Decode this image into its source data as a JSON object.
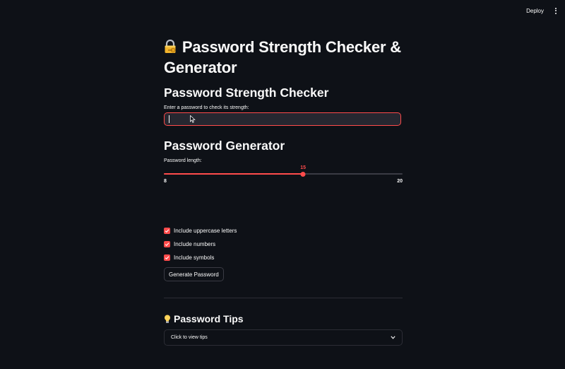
{
  "header": {
    "deploy_label": "Deploy",
    "menu_icon": "more-vertical-icon"
  },
  "page": {
    "title_line1": "Password Strength Checker &",
    "title_line2": "Generator",
    "title_icon": "lock-with-key-icon"
  },
  "checker": {
    "heading": "Password Strength Checker",
    "input_label": "Enter a password to check its strength:",
    "input_value": ""
  },
  "generator": {
    "heading": "Password Generator",
    "length_label": "Password length:",
    "length_value": 15,
    "length_min": 8,
    "length_max": 20,
    "length_value_text": "15",
    "length_min_text": "8",
    "length_max_text": "20",
    "options": [
      {
        "label": "Include uppercase letters",
        "checked": true
      },
      {
        "label": "Include numbers",
        "checked": true
      },
      {
        "label": "Include symbols",
        "checked": true
      }
    ],
    "button_label": "Generate Password"
  },
  "tips": {
    "heading": "Password Tips",
    "heading_icon": "light-bulb-icon",
    "expander_label": "Click to view tips"
  },
  "colors": {
    "accent": "#ff4b4b",
    "background": "#0e1117",
    "input_bg": "#262730"
  }
}
